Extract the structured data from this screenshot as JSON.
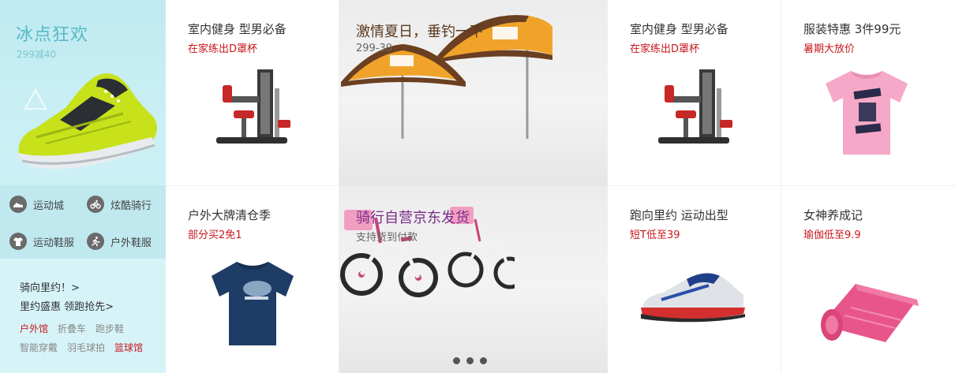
{
  "left_promo": {
    "title": "冰点狂欢",
    "subtitle": "299减40",
    "links": [
      {
        "label": "运动城",
        "icon": "sport-shoe-icon"
      },
      {
        "label": "炫酷骑行",
        "icon": "bicycle-icon"
      },
      {
        "label": "运动鞋服",
        "icon": "clothing-icon"
      },
      {
        "label": "户外鞋服",
        "icon": "runner-icon"
      }
    ],
    "line1": "骑向里约！>",
    "line2": "里约盛惠 领跑抢先>",
    "tags_row1": [
      {
        "label": "户外馆",
        "highlight": true
      },
      {
        "label": "折叠车",
        "highlight": false
      },
      {
        "label": "跑步鞋",
        "highlight": false
      }
    ],
    "tags_row2": [
      {
        "label": "智能穿戴",
        "highlight": false
      },
      {
        "label": "羽毛球拍",
        "highlight": false
      },
      {
        "label": "篮球馆",
        "highlight": true
      }
    ]
  },
  "tiles": [
    {
      "title": "室内健身 型男必备",
      "subtitle": "在家练出D罩杯",
      "image": "fitness-machine"
    },
    {
      "title": "室内健身 型男必备",
      "subtitle": "在家练出D罩杯",
      "image": "fitness-machine"
    },
    {
      "title": "服装特惠 3件99元",
      "subtitle": "暑期大放价",
      "image": "pink-tshirt"
    },
    {
      "title": "户外大牌清仓季",
      "subtitle": "部分买2免1",
      "image": "navy-tshirt"
    },
    {
      "title": "跑向里约 运动出型",
      "subtitle": "短T低至39",
      "image": "running-shoe"
    },
    {
      "title": "女神养成记",
      "subtitle": "瑜伽低至9.9",
      "image": "yoga-mat"
    }
  ],
  "featured": [
    {
      "title": "激情夏日，垂钓一下",
      "subtitle": "299-30",
      "title_color": "#5a3a20",
      "image": "fishing-umbrellas"
    },
    {
      "title": "骑行自营京东发货",
      "subtitle": "支持货到付款",
      "title_color": "#7b2a8a",
      "image": "kids-bicycles"
    }
  ],
  "carousel": {
    "dots": 3
  },
  "colors": {
    "accent_red": "#c8161d",
    "promo_teal": "#58b8c6"
  }
}
